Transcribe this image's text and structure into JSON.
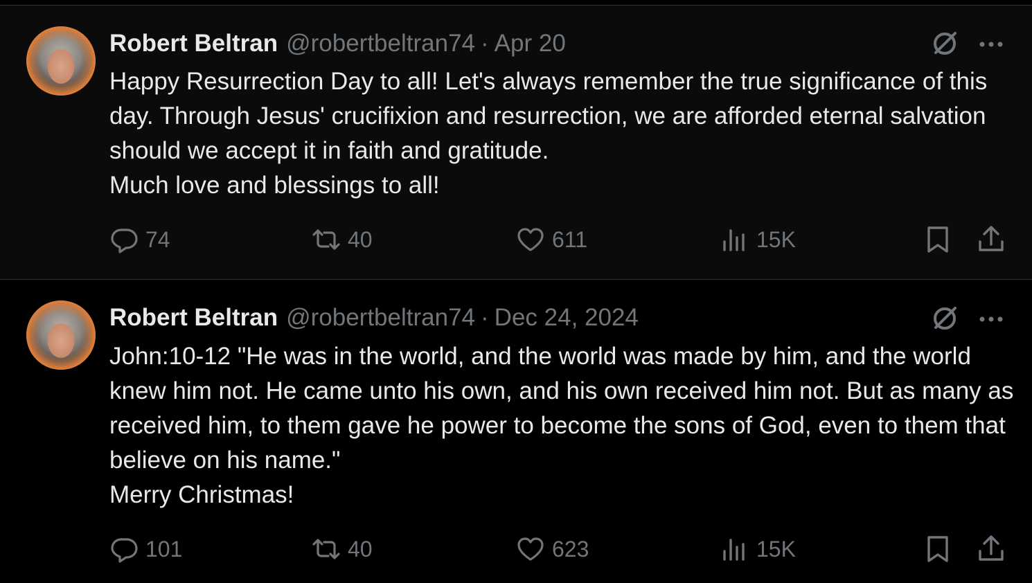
{
  "tweets": [
    {
      "name": "Robert Beltran",
      "handle": "@robertbeltran74",
      "separator": "·",
      "date": "Apr 20",
      "text": "Happy Resurrection Day to all! Let's always remember the true significance of this day. Through Jesus' crucifixion and resurrection, we are afforded eternal salvation should we accept it in faith and gratitude.\nMuch love and blessings to all!",
      "replies": "74",
      "reposts": "40",
      "likes": "611",
      "views": "15K"
    },
    {
      "name": "Robert Beltran",
      "handle": "@robertbeltran74",
      "separator": "·",
      "date": "Dec 24, 2024",
      "text": "John:10-12 \"He was in the world, and the world was made by him, and the world knew him not. He came unto his own, and his own received him not. But as many as received him, to them gave he power to become the sons of God, even to them that believe on his name.\"\nMerry Christmas!",
      "replies": "101",
      "reposts": "40",
      "likes": "623",
      "views": "15K"
    }
  ],
  "icons": {
    "reply": "reply-icon",
    "repost": "repost-icon",
    "like": "heart-icon",
    "views": "views-icon",
    "bookmark": "bookmark-icon",
    "share": "share-icon",
    "grok": "grok-icon",
    "more": "more-icon"
  },
  "colors": {
    "background": "#000000",
    "text": "#e7e9ea",
    "muted": "#71767b",
    "divider": "#2f3336"
  }
}
